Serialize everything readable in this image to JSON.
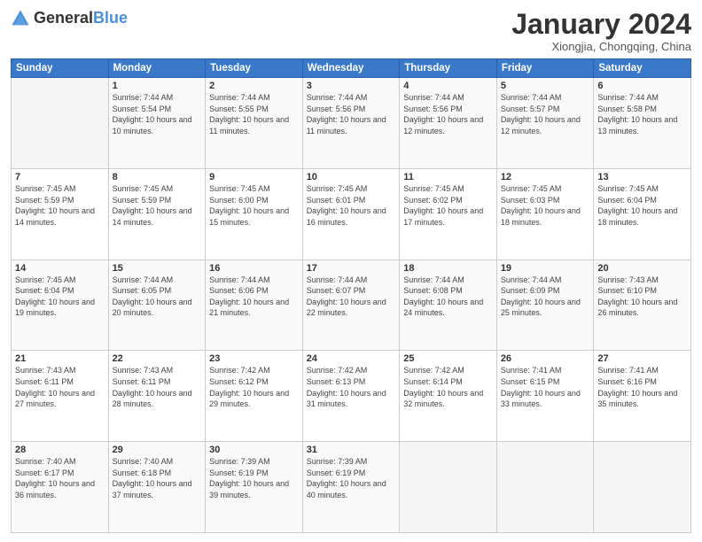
{
  "logo": {
    "general": "General",
    "blue": "Blue"
  },
  "header": {
    "title": "January 2024",
    "subtitle": "Xiongjia, Chongqing, China"
  },
  "days": [
    "Sunday",
    "Monday",
    "Tuesday",
    "Wednesday",
    "Thursday",
    "Friday",
    "Saturday"
  ],
  "weeks": [
    [
      {
        "day": "",
        "info": ""
      },
      {
        "day": "1",
        "info": "Sunrise: 7:44 AM\nSunset: 5:54 PM\nDaylight: 10 hours and 10 minutes."
      },
      {
        "day": "2",
        "info": "Sunrise: 7:44 AM\nSunset: 5:55 PM\nDaylight: 10 hours and 11 minutes."
      },
      {
        "day": "3",
        "info": "Sunrise: 7:44 AM\nSunset: 5:56 PM\nDaylight: 10 hours and 11 minutes."
      },
      {
        "day": "4",
        "info": "Sunrise: 7:44 AM\nSunset: 5:56 PM\nDaylight: 10 hours and 12 minutes."
      },
      {
        "day": "5",
        "info": "Sunrise: 7:44 AM\nSunset: 5:57 PM\nDaylight: 10 hours and 12 minutes."
      },
      {
        "day": "6",
        "info": "Sunrise: 7:44 AM\nSunset: 5:58 PM\nDaylight: 10 hours and 13 minutes."
      }
    ],
    [
      {
        "day": "7",
        "info": "Sunrise: 7:45 AM\nSunset: 5:59 PM\nDaylight: 10 hours and 14 minutes."
      },
      {
        "day": "8",
        "info": "Sunrise: 7:45 AM\nSunset: 5:59 PM\nDaylight: 10 hours and 14 minutes."
      },
      {
        "day": "9",
        "info": "Sunrise: 7:45 AM\nSunset: 6:00 PM\nDaylight: 10 hours and 15 minutes."
      },
      {
        "day": "10",
        "info": "Sunrise: 7:45 AM\nSunset: 6:01 PM\nDaylight: 10 hours and 16 minutes."
      },
      {
        "day": "11",
        "info": "Sunrise: 7:45 AM\nSunset: 6:02 PM\nDaylight: 10 hours and 17 minutes."
      },
      {
        "day": "12",
        "info": "Sunrise: 7:45 AM\nSunset: 6:03 PM\nDaylight: 10 hours and 18 minutes."
      },
      {
        "day": "13",
        "info": "Sunrise: 7:45 AM\nSunset: 6:04 PM\nDaylight: 10 hours and 18 minutes."
      }
    ],
    [
      {
        "day": "14",
        "info": "Sunrise: 7:45 AM\nSunset: 6:04 PM\nDaylight: 10 hours and 19 minutes."
      },
      {
        "day": "15",
        "info": "Sunrise: 7:44 AM\nSunset: 6:05 PM\nDaylight: 10 hours and 20 minutes."
      },
      {
        "day": "16",
        "info": "Sunrise: 7:44 AM\nSunset: 6:06 PM\nDaylight: 10 hours and 21 minutes."
      },
      {
        "day": "17",
        "info": "Sunrise: 7:44 AM\nSunset: 6:07 PM\nDaylight: 10 hours and 22 minutes."
      },
      {
        "day": "18",
        "info": "Sunrise: 7:44 AM\nSunset: 6:08 PM\nDaylight: 10 hours and 24 minutes."
      },
      {
        "day": "19",
        "info": "Sunrise: 7:44 AM\nSunset: 6:09 PM\nDaylight: 10 hours and 25 minutes."
      },
      {
        "day": "20",
        "info": "Sunrise: 7:43 AM\nSunset: 6:10 PM\nDaylight: 10 hours and 26 minutes."
      }
    ],
    [
      {
        "day": "21",
        "info": "Sunrise: 7:43 AM\nSunset: 6:11 PM\nDaylight: 10 hours and 27 minutes."
      },
      {
        "day": "22",
        "info": "Sunrise: 7:43 AM\nSunset: 6:11 PM\nDaylight: 10 hours and 28 minutes."
      },
      {
        "day": "23",
        "info": "Sunrise: 7:42 AM\nSunset: 6:12 PM\nDaylight: 10 hours and 29 minutes."
      },
      {
        "day": "24",
        "info": "Sunrise: 7:42 AM\nSunset: 6:13 PM\nDaylight: 10 hours and 31 minutes."
      },
      {
        "day": "25",
        "info": "Sunrise: 7:42 AM\nSunset: 6:14 PM\nDaylight: 10 hours and 32 minutes."
      },
      {
        "day": "26",
        "info": "Sunrise: 7:41 AM\nSunset: 6:15 PM\nDaylight: 10 hours and 33 minutes."
      },
      {
        "day": "27",
        "info": "Sunrise: 7:41 AM\nSunset: 6:16 PM\nDaylight: 10 hours and 35 minutes."
      }
    ],
    [
      {
        "day": "28",
        "info": "Sunrise: 7:40 AM\nSunset: 6:17 PM\nDaylight: 10 hours and 36 minutes."
      },
      {
        "day": "29",
        "info": "Sunrise: 7:40 AM\nSunset: 6:18 PM\nDaylight: 10 hours and 37 minutes."
      },
      {
        "day": "30",
        "info": "Sunrise: 7:39 AM\nSunset: 6:19 PM\nDaylight: 10 hours and 39 minutes."
      },
      {
        "day": "31",
        "info": "Sunrise: 7:39 AM\nSunset: 6:19 PM\nDaylight: 10 hours and 40 minutes."
      },
      {
        "day": "",
        "info": ""
      },
      {
        "day": "",
        "info": ""
      },
      {
        "day": "",
        "info": ""
      }
    ]
  ]
}
